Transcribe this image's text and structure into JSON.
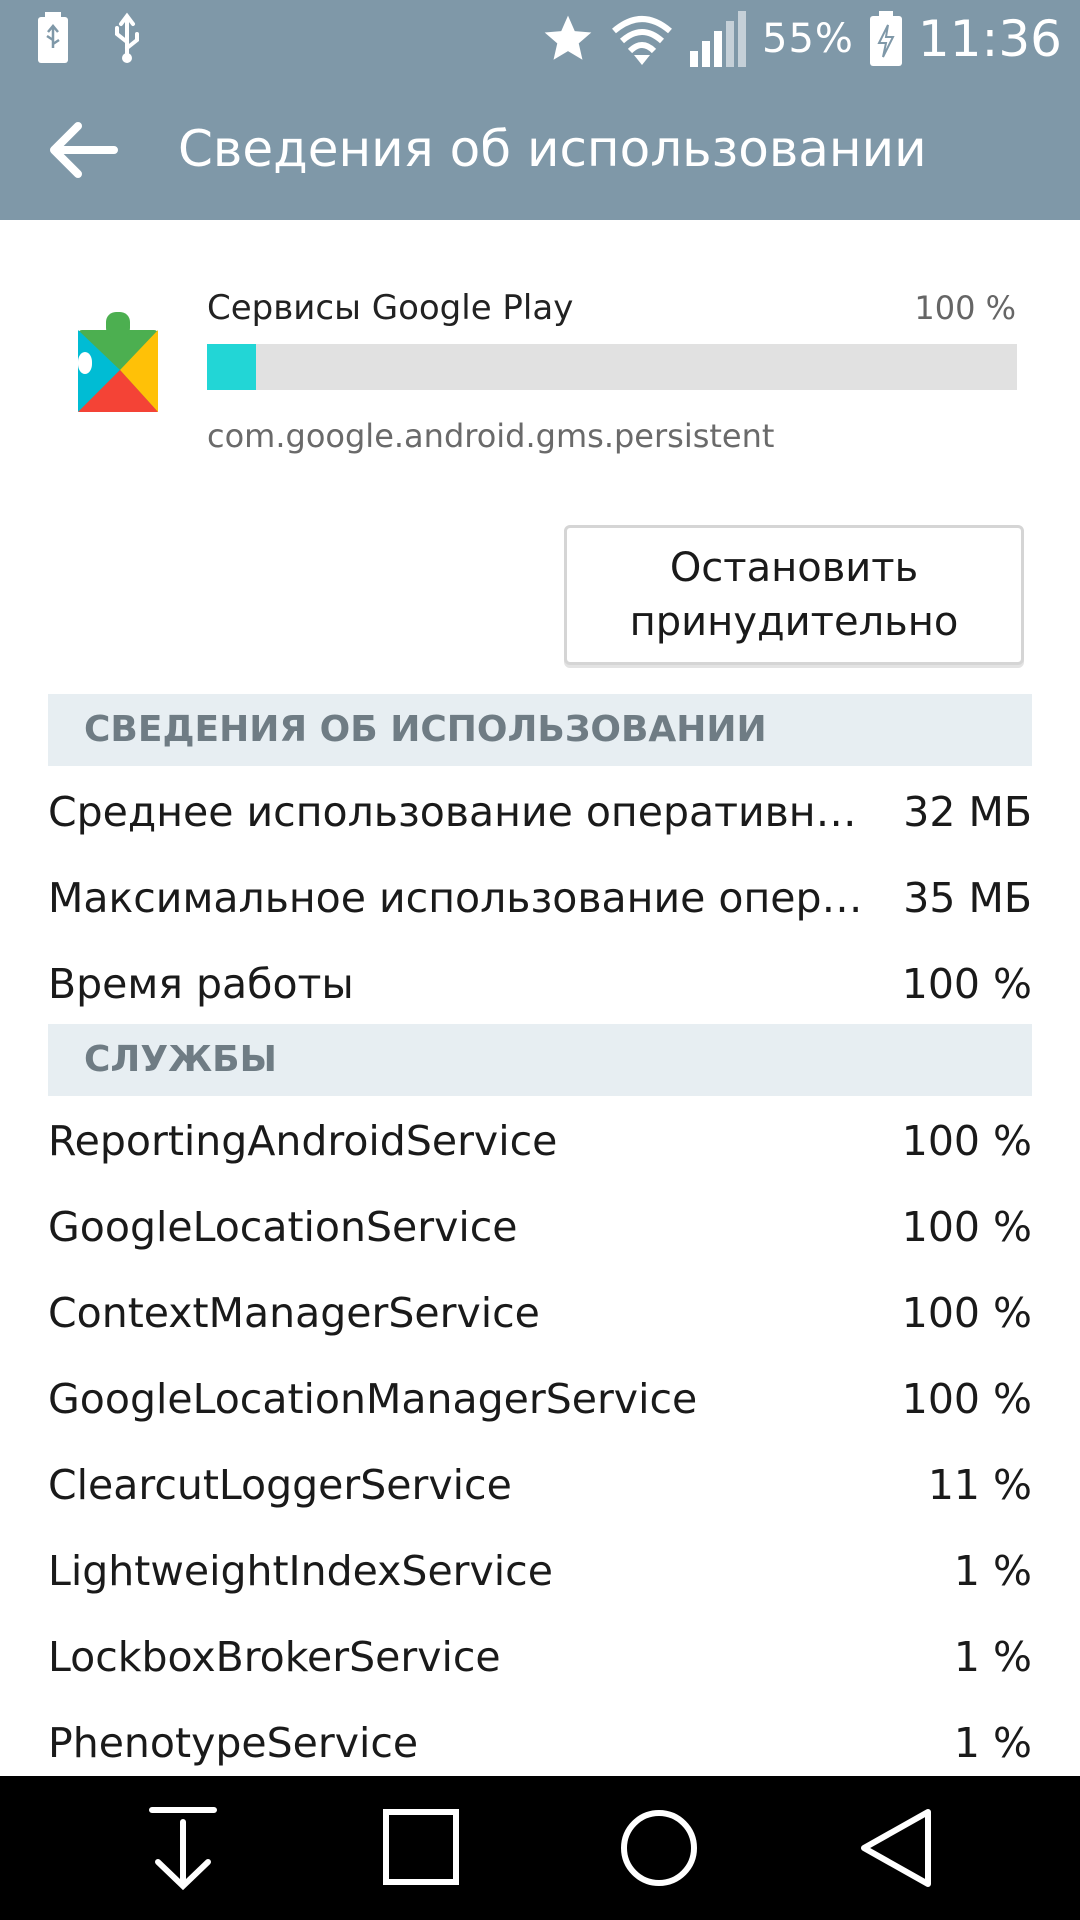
{
  "status_bar": {
    "battery_percent": "55%",
    "time": "11:36",
    "icons": [
      "battery-usb-icon",
      "usb-icon",
      "star-icon",
      "wifi-icon",
      "signal-icon",
      "battery-charging-icon"
    ]
  },
  "app_bar": {
    "title": "Сведения об использовании",
    "back_icon": "arrow-back-icon"
  },
  "app": {
    "name": "Сервисы Google Play",
    "percent": "100 %",
    "usage_fraction": 0.06,
    "package": "com.google.android.gms.persistent",
    "bar_color": "#22d6d6"
  },
  "force_stop": {
    "line1": "Остановить",
    "line2": "принудительно"
  },
  "usage_section": {
    "header": "СВЕДЕНИЯ ОБ ИСПОЛЬЗОВАНИИ",
    "rows": [
      {
        "label": "Среднее использование оперативной памяти",
        "value": "32 МБ"
      },
      {
        "label": "Максимальное использование оперативной памяти",
        "value": "35 МБ"
      },
      {
        "label": "Время работы",
        "value": "100 %"
      }
    ]
  },
  "services_section": {
    "header": "СЛУЖБЫ",
    "rows": [
      {
        "label": "ReportingAndroidService",
        "value": "100 %"
      },
      {
        "label": "GoogleLocationService",
        "value": "100 %"
      },
      {
        "label": "ContextManagerService",
        "value": "100 %"
      },
      {
        "label": "GoogleLocationManagerService",
        "value": "100 %"
      },
      {
        "label": "ClearcutLoggerService",
        "value": "11 %"
      },
      {
        "label": "LightweightIndexService",
        "value": "1 %"
      },
      {
        "label": "LockboxBrokerService",
        "value": "1 %"
      },
      {
        "label": "PhenotypeService",
        "value": "1 %"
      }
    ]
  },
  "nav_bar": {
    "icons": [
      "download-arrow-icon",
      "recents-square-icon",
      "home-circle-icon",
      "back-triangle-icon"
    ]
  },
  "colors": {
    "bar_background": "#7f98a8",
    "section_header_bg": "#e7eef2",
    "section_header_text": "#6f7c84"
  }
}
